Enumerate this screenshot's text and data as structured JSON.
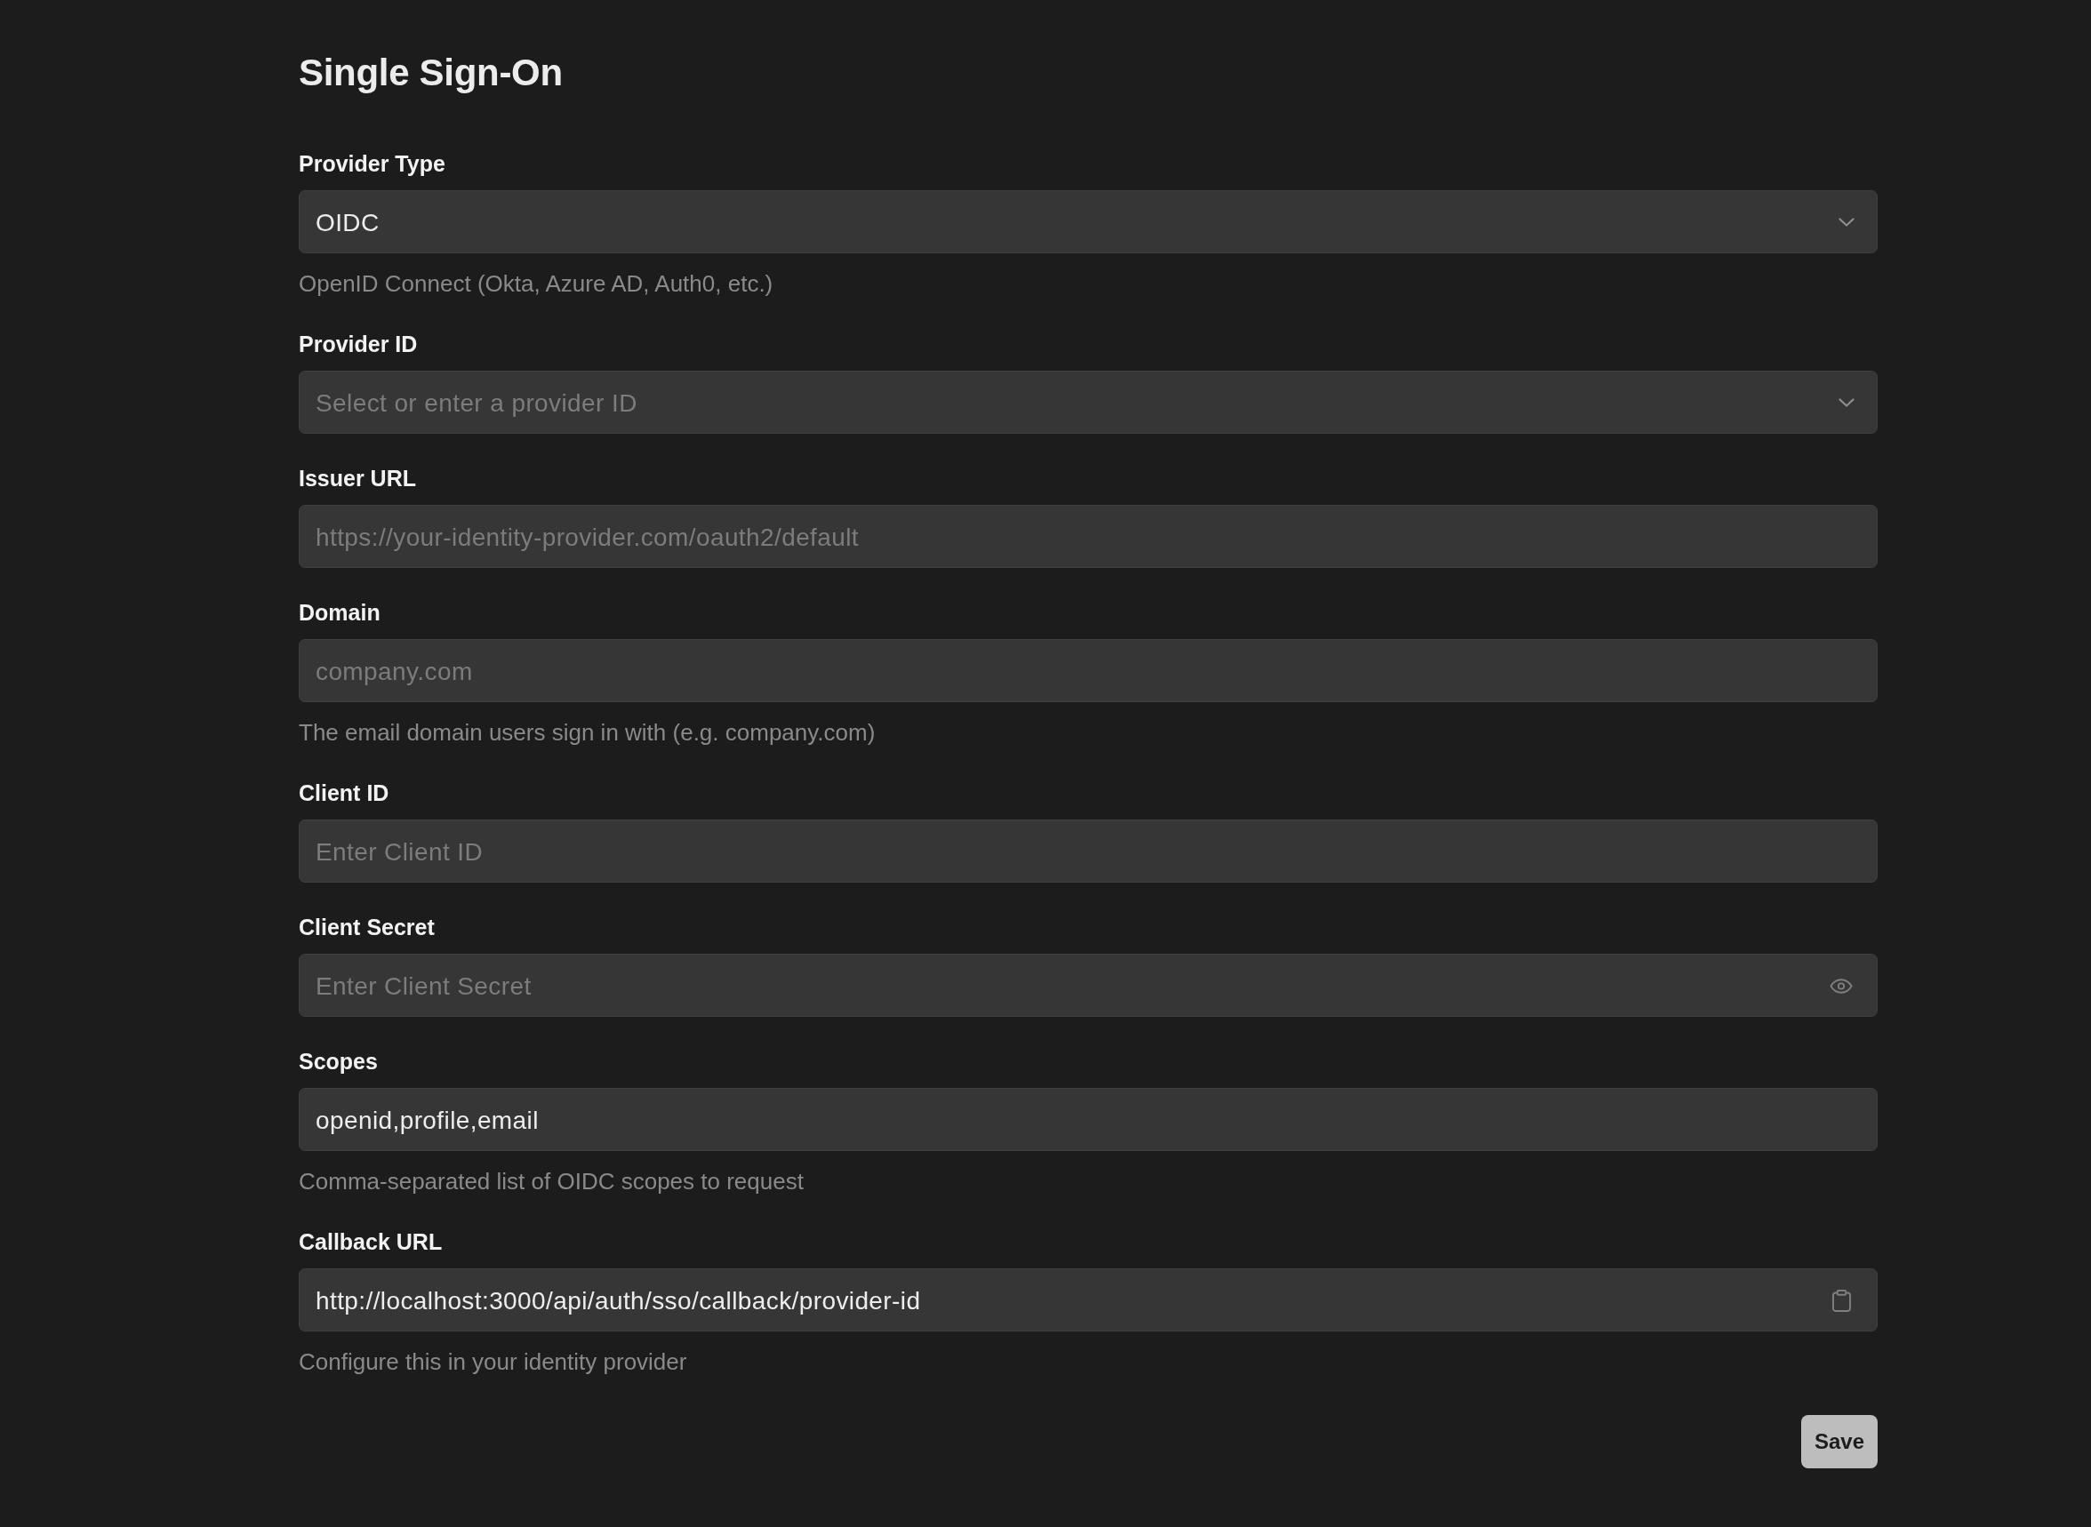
{
  "page": {
    "title": "Single Sign-On"
  },
  "fields": [
    {
      "kind": "select",
      "label": "Provider Type",
      "value": "OIDC",
      "help": "OpenID Connect (Okta, Azure AD, Auth0, etc.)"
    },
    {
      "kind": "select",
      "label": "Provider ID",
      "placeholder": "Select or enter a provider ID"
    },
    {
      "kind": "text",
      "label": "Issuer URL",
      "placeholder": "https://your-identity-provider.com/oauth2/default"
    },
    {
      "kind": "text",
      "label": "Domain",
      "placeholder": "company.com",
      "help": "The email domain users sign in with (e.g. company.com)"
    },
    {
      "kind": "text",
      "label": "Client ID",
      "placeholder": "Enter Client ID"
    },
    {
      "kind": "password",
      "label": "Client Secret",
      "placeholder": "Enter Client Secret"
    },
    {
      "kind": "text",
      "label": "Scopes",
      "value": "openid,profile,email",
      "help": "Comma-separated list of OIDC scopes to request"
    },
    {
      "kind": "copy",
      "label": "Callback URL",
      "value": "http://localhost:3000/api/auth/sso/callback/provider-id",
      "help": "Configure this in your identity provider"
    }
  ],
  "save_button": "Save"
}
